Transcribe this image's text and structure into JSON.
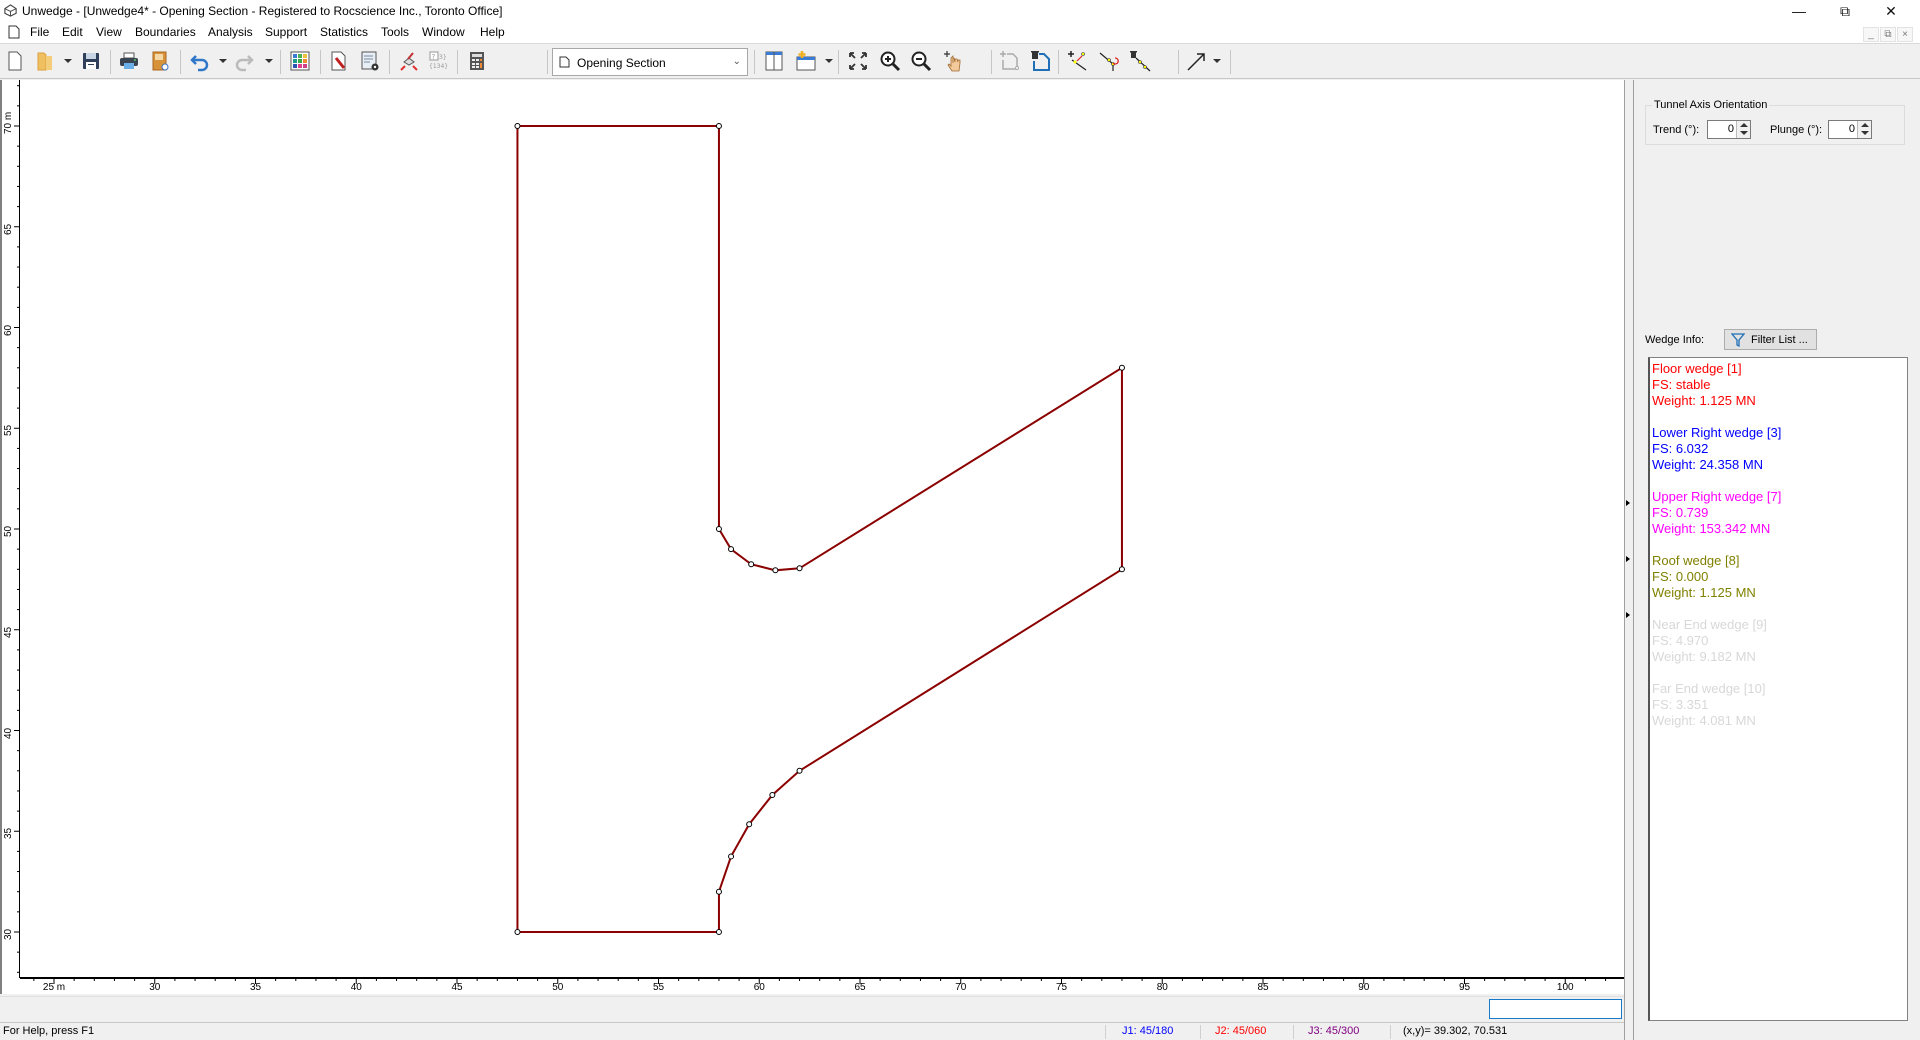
{
  "window": {
    "title": "Unwedge - [Unwedge4* - Opening Section - Registered to Rocscience Inc., Toronto Office]",
    "controls": {
      "minimize": "—",
      "restore": "⧉",
      "close": "✕"
    },
    "mdi_controls": {
      "minimize": "_",
      "restore": "⧉",
      "close": "×"
    }
  },
  "menu": [
    "File",
    "Edit",
    "View",
    "Boundaries",
    "Analysis",
    "Support",
    "Statistics",
    "Tools",
    "Window",
    "Help"
  ],
  "toolbar": {
    "view_select": {
      "selected": "Opening Section"
    },
    "buttons": [
      "new-file",
      "open-file",
      "save",
      "print",
      "print-preview",
      "undo",
      "redo",
      "display-options",
      "input-data",
      "project-settings",
      "compute",
      "info-viewer",
      "calculator",
      "tile-vertical",
      "new-window",
      "zoom-extents",
      "zoom-in",
      "zoom-out",
      "pan",
      "add-boundary",
      "delete-boundary",
      "add-vertex",
      "move-vertex",
      "delete-vertex",
      "arrow"
    ]
  },
  "canvas": {
    "x_axis": {
      "unit": "m",
      "ticks": [
        25,
        30,
        35,
        40,
        45,
        50,
        55,
        60,
        65,
        70,
        75,
        80,
        85,
        90,
        95,
        100
      ],
      "first_label": "25 m"
    },
    "y_axis": {
      "unit": "m",
      "ticks": [
        30,
        35,
        40,
        45,
        50,
        55,
        60,
        65,
        70
      ],
      "top_label": "70 m"
    },
    "boundary_color": "#8b0000",
    "boundary_vertices_m": [
      [
        48,
        70
      ],
      [
        58,
        70
      ],
      [
        58,
        50
      ],
      [
        58.6,
        49
      ],
      [
        59.6,
        48.25
      ],
      [
        60.8,
        47.95
      ],
      [
        62,
        48.05
      ],
      [
        78,
        58
      ],
      [
        78,
        48
      ],
      [
        62,
        38
      ],
      [
        60.65,
        36.8
      ],
      [
        59.5,
        35.35
      ],
      [
        58.6,
        33.75
      ],
      [
        58,
        32
      ],
      [
        58,
        30
      ],
      [
        48,
        30
      ]
    ]
  },
  "command_input": {
    "value": ""
  },
  "status": {
    "help": "For Help, press F1",
    "j1": {
      "text": "J1: 45/180",
      "color": "#0000ff"
    },
    "j2": {
      "text": "J2: 45/060",
      "color": "#ff0000"
    },
    "j3": {
      "text": "J3: 45/300",
      "color": "#800080"
    },
    "coords": "(x,y)= 39.302, 70.531"
  },
  "right_panel": {
    "tunnel_axis": {
      "title": "Tunnel Axis Orientation",
      "trend_label": "Trend (°):",
      "trend_value": "0",
      "plunge_label": "Plunge (°):",
      "plunge_value": "0"
    },
    "wedge_info_label": "Wedge Info:",
    "filter_button": "Filter List ...",
    "wedges": [
      {
        "name": "Floor wedge [1]",
        "fs": "FS: stable",
        "weight": "Weight: 1.125 MN",
        "color": "#ff0000"
      },
      {
        "name": "Lower Right wedge [3]",
        "fs": "FS: 6.032",
        "weight": "Weight: 24.358 MN",
        "color": "#0000ff"
      },
      {
        "name": "Upper Right wedge [7]",
        "fs": "FS: 0.739",
        "weight": "Weight: 153.342 MN",
        "color": "#ff00ff"
      },
      {
        "name": "Roof wedge [8]",
        "fs": "FS: 0.000",
        "weight": "Weight: 1.125 MN",
        "color": "#808000"
      },
      {
        "name": "Near End wedge [9]",
        "fs": "FS: 4.970",
        "weight": "Weight: 9.182 MN",
        "color": "#d8d8d8"
      },
      {
        "name": "Far End wedge [10]",
        "fs": "FS: 3.351",
        "weight": "Weight: 4.081 MN",
        "color": "#d8d8d8"
      }
    ]
  }
}
